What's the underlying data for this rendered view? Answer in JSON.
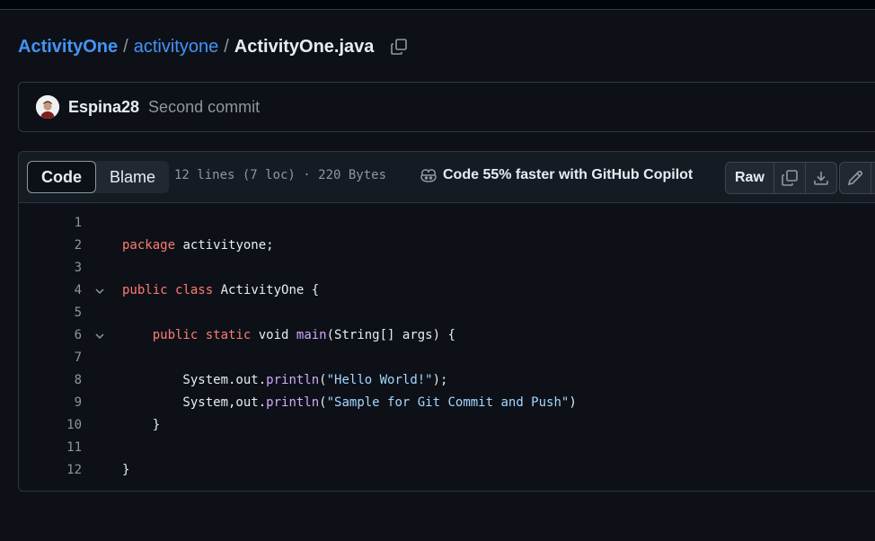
{
  "breadcrumb": {
    "repo": "ActivityOne",
    "separator": "/",
    "folder": "activityone",
    "file": "ActivityOne.java",
    "copy_icon": "copy-icon"
  },
  "commit": {
    "author": "Espina28",
    "message": "Second commit",
    "avatar_icon": "avatar"
  },
  "file_header": {
    "tabs": [
      {
        "label": "Code",
        "active": true
      },
      {
        "label": "Blame",
        "active": false
      }
    ],
    "meta": "12 lines (7 loc) · 220 Bytes",
    "copilot_text": "Code 55% faster with GitHub Copilot",
    "copilot_icon": "copilot-icon",
    "raw_label": "Raw",
    "icons": [
      "copy-icon",
      "download-icon",
      "pencil-icon"
    ]
  },
  "code": {
    "line_numbers": [
      "1",
      "2",
      "3",
      "4",
      "5",
      "6",
      "7",
      "8",
      "9",
      "10",
      "11",
      "12"
    ],
    "folded_lines": [
      4,
      6
    ],
    "lines": [
      [],
      [
        {
          "t": "package",
          "c": "kw"
        },
        {
          "t": " activityone;",
          "c": ""
        }
      ],
      [],
      [
        {
          "t": "public",
          "c": "kw"
        },
        {
          "t": " ",
          "c": ""
        },
        {
          "t": "class",
          "c": "kw"
        },
        {
          "t": " ActivityOne {",
          "c": ""
        }
      ],
      [],
      [
        {
          "t": "    ",
          "c": ""
        },
        {
          "t": "public",
          "c": "kw"
        },
        {
          "t": " ",
          "c": ""
        },
        {
          "t": "static",
          "c": "kw"
        },
        {
          "t": " void ",
          "c": ""
        },
        {
          "t": "main",
          "c": "fn"
        },
        {
          "t": "(String[] args) {",
          "c": ""
        }
      ],
      [],
      [
        {
          "t": "        System.out.",
          "c": ""
        },
        {
          "t": "println",
          "c": "fn"
        },
        {
          "t": "(",
          "c": ""
        },
        {
          "t": "\"Hello World!\"",
          "c": "str"
        },
        {
          "t": ");",
          "c": ""
        }
      ],
      [
        {
          "t": "        System,out.",
          "c": ""
        },
        {
          "t": "println",
          "c": "fn"
        },
        {
          "t": "(",
          "c": ""
        },
        {
          "t": "\"Sample for Git Commit and Push\"",
          "c": "str"
        },
        {
          "t": ")",
          "c": ""
        }
      ],
      [
        {
          "t": "    }",
          "c": ""
        }
      ],
      [],
      [
        {
          "t": "}",
          "c": ""
        }
      ]
    ]
  },
  "colors": {
    "background": "#0d1117",
    "link": "#4493f8",
    "keyword": "#ff7b72",
    "function": "#d2a8ff",
    "string": "#a5d6ff"
  }
}
